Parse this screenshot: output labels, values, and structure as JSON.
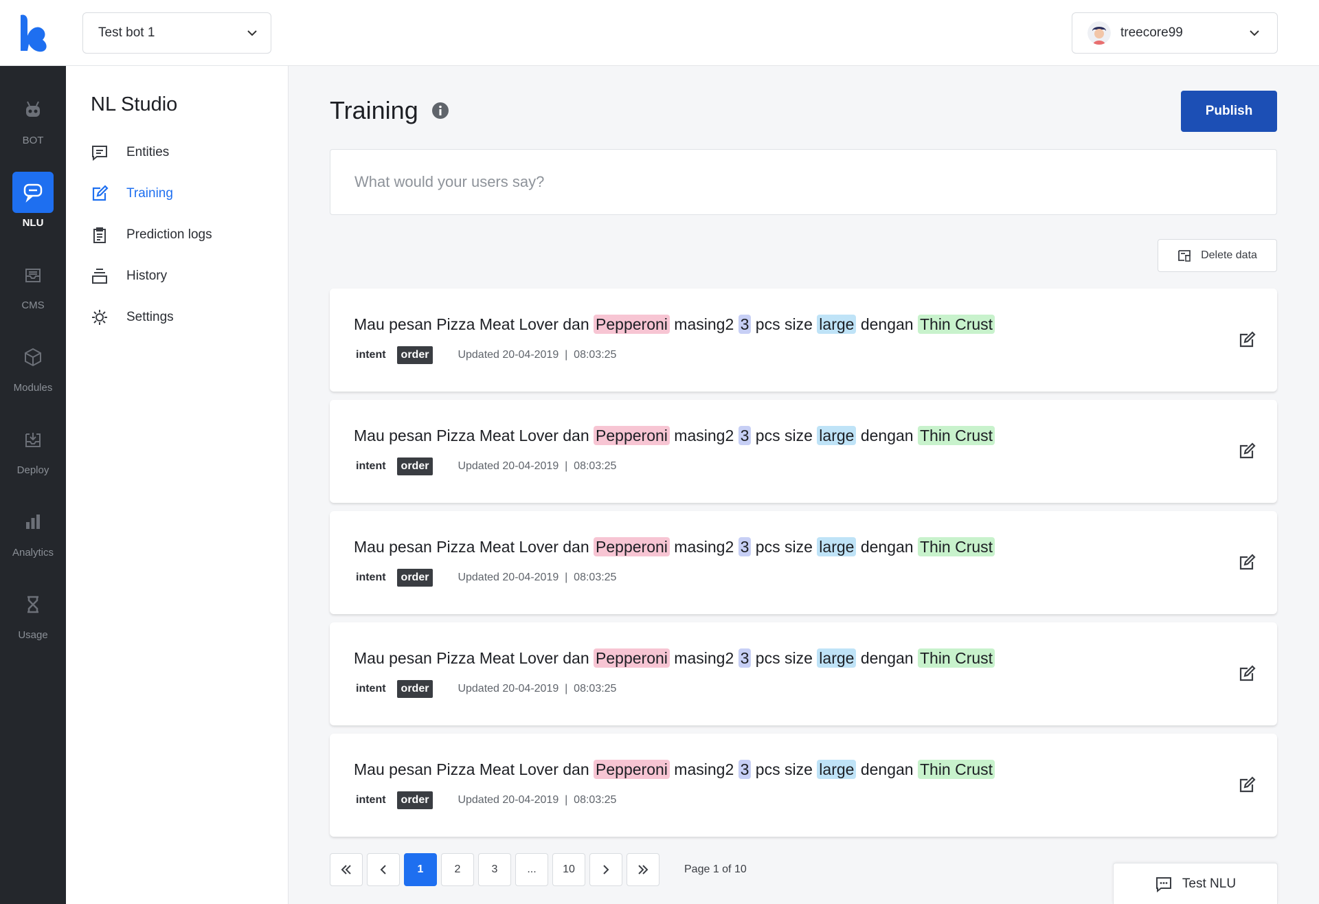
{
  "colors": {
    "accent": "#1e6ff0",
    "publish": "#1c4fb5",
    "rail": "#24272c",
    "entity_product": "#f7c5d3",
    "entity_qty": "#c7cff5",
    "entity_size": "#bfe3f7",
    "entity_crust": "#c8f2cc"
  },
  "header": {
    "bot_select": "Test bot 1",
    "username": "treecore99"
  },
  "rail": {
    "items": [
      {
        "label": "BOT",
        "icon": "robot-icon"
      },
      {
        "label": "NLU",
        "icon": "chat-bubbles-icon"
      },
      {
        "label": "CMS",
        "icon": "inbox-tray-icon"
      },
      {
        "label": "Modules",
        "icon": "cube-icon"
      },
      {
        "label": "Deploy",
        "icon": "download-tray-icon"
      },
      {
        "label": "Analytics",
        "icon": "bar-chart-icon"
      },
      {
        "label": "Usage",
        "icon": "hourglass-icon"
      }
    ]
  },
  "sidenav": {
    "title": "NL Studio",
    "items": [
      {
        "label": "Entities",
        "icon": "comment-icon"
      },
      {
        "label": "Training",
        "icon": "edit-icon"
      },
      {
        "label": "Prediction logs",
        "icon": "clipboard-icon"
      },
      {
        "label": "History",
        "icon": "stack-icon"
      },
      {
        "label": "Settings",
        "icon": "gear-icon"
      }
    ]
  },
  "main": {
    "title": "Training",
    "publish_label": "Publish",
    "input_placeholder": "What would your users say?",
    "delete_label": "Delete data"
  },
  "utterances": [
    {
      "parts": [
        "Mau pesan Pizza Meat Lover dan ",
        "Pepperoni",
        " masing2 ",
        "3",
        " pcs size ",
        "large",
        " dengan ",
        "Thin Crust"
      ],
      "intent_label": "intent",
      "intent": "order",
      "updated": "Updated 20-04-2019  |  08:03:25"
    },
    {
      "parts": [
        "Mau pesan Pizza Meat Lover dan ",
        "Pepperoni",
        " masing2 ",
        "3",
        " pcs size ",
        "large",
        " dengan ",
        "Thin Crust"
      ],
      "intent_label": "intent",
      "intent": "order",
      "updated": "Updated 20-04-2019  |  08:03:25"
    },
    {
      "parts": [
        "Mau pesan Pizza Meat Lover dan ",
        "Pepperoni",
        " masing2 ",
        "3",
        " pcs size ",
        "large",
        " dengan ",
        "Thin Crust"
      ],
      "intent_label": "intent",
      "intent": "order",
      "updated": "Updated 20-04-2019  |  08:03:25"
    },
    {
      "parts": [
        "Mau pesan Pizza Meat Lover dan ",
        "Pepperoni",
        " masing2 ",
        "3",
        " pcs size ",
        "large",
        " dengan ",
        "Thin Crust"
      ],
      "intent_label": "intent",
      "intent": "order",
      "updated": "Updated 20-04-2019  |  08:03:25"
    },
    {
      "parts": [
        "Mau pesan Pizza Meat Lover dan ",
        "Pepperoni",
        " masing2 ",
        "3",
        " pcs size ",
        "large",
        " dengan ",
        "Thin Crust"
      ],
      "intent_label": "intent",
      "intent": "order",
      "updated": "Updated 20-04-2019  |  08:03:25"
    }
  ],
  "pagination": {
    "pages": [
      "1",
      "2",
      "3",
      "...",
      "10"
    ],
    "current": "1",
    "info": "Page 1 of 10"
  },
  "test_nlu_label": "Test NLU"
}
